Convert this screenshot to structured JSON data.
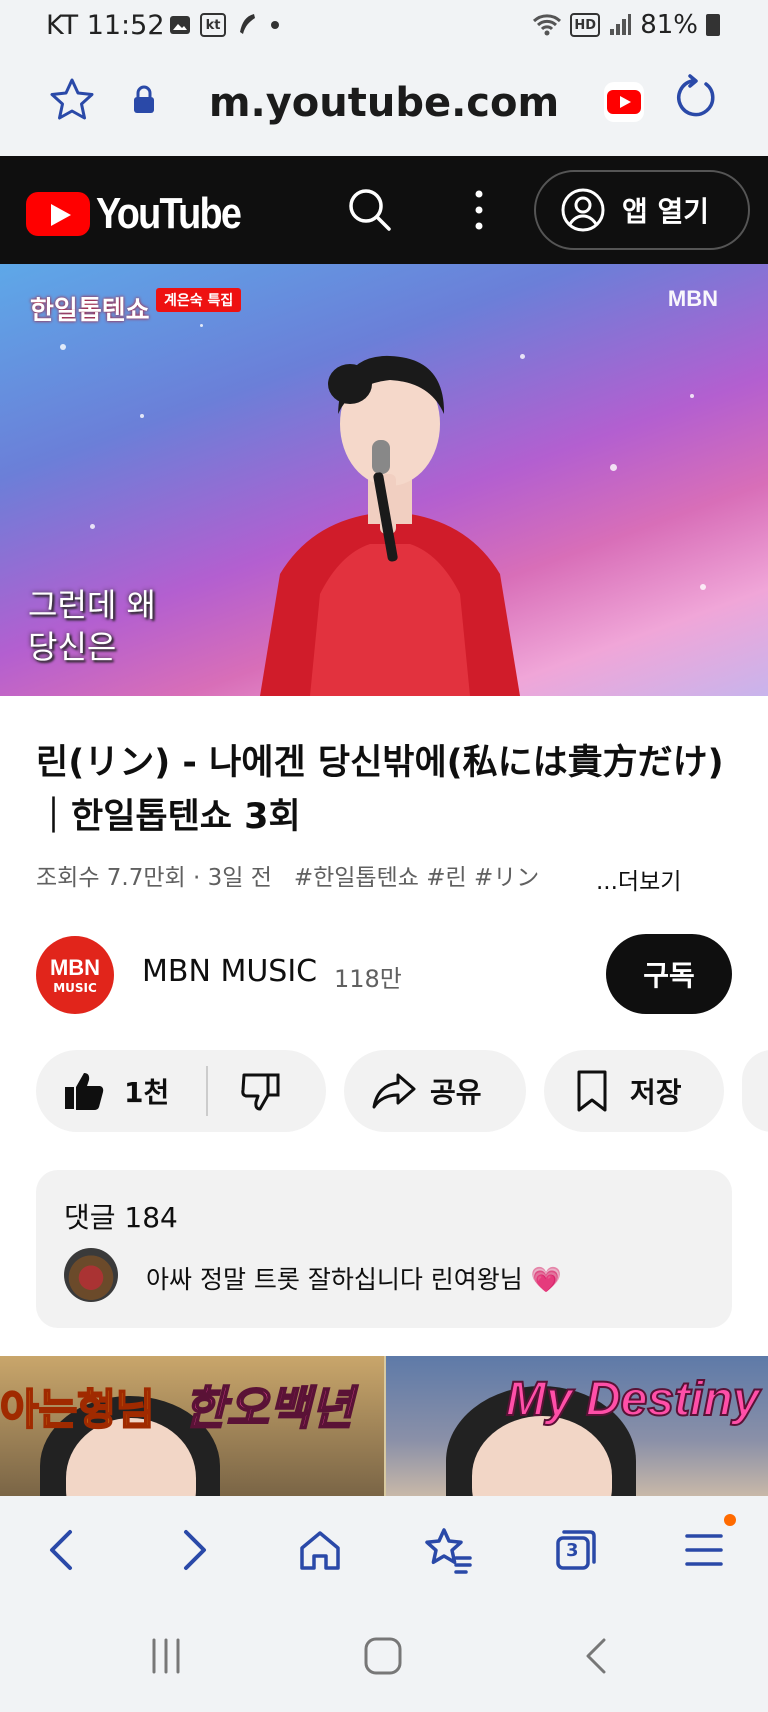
{
  "status_bar": {
    "carrier": "KT",
    "time": "11:52",
    "kt_badge": "kt",
    "hd_badge": "HD",
    "battery": "81%"
  },
  "browser": {
    "url": "m.youtube.com"
  },
  "youtube_header": {
    "logo_text": "YouTube",
    "open_app_label": "앱 열기"
  },
  "video": {
    "show_logo": "한일톱텐쇼",
    "special_badge": "계은숙 특집",
    "watermark": "MBN",
    "subtitle_line1": "그런데 왜",
    "subtitle_line2": "당신은"
  },
  "video_info": {
    "title": "린(リン) - 나에겐 당신밖에(私には貴方だけ)｜한일톱텐쇼 3회",
    "views": "조회수 7.7만회",
    "date": "3일 전",
    "tags": "#한일톱텐쇼 #린 #リン",
    "more_label": "...더보기"
  },
  "channel": {
    "avatar_text": "MBN",
    "avatar_sub": "MUSIC",
    "name": "MBN MUSIC",
    "subscribers": "118만",
    "subscribe_label": "구독"
  },
  "actions": {
    "like_count": "1천",
    "share_label": "공유",
    "save_label": "저장"
  },
  "comments": {
    "header": "댓글 184",
    "top_comment": "아싸 정말 트롯 잘하십니다 린여왕님 💗"
  },
  "next_video": {
    "text_left": "아는형님",
    "text_mid": "한오백년",
    "text_right": "My Destiny"
  },
  "toolbar": {
    "tab_count": "3"
  },
  "colors": {
    "youtube_red": "#ff0000",
    "browser_blue": "#2a49a8",
    "header_bg": "#0f0f0f"
  }
}
